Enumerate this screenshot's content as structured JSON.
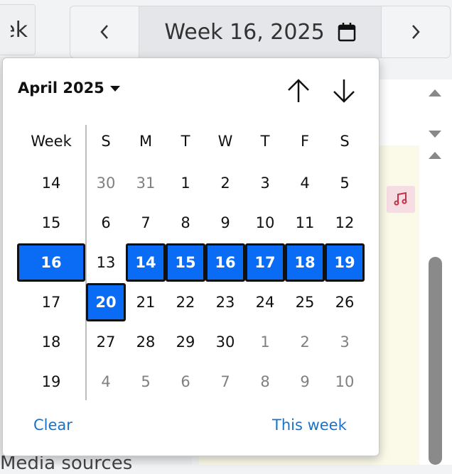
{
  "background": {
    "week_button_label": "Week",
    "week_display": "Week 16, 2025",
    "media_text": "Media sources"
  },
  "picker": {
    "month_label": "April 2025",
    "week_header": "Week",
    "day_headers": [
      "S",
      "M",
      "T",
      "W",
      "T",
      "F",
      "S"
    ],
    "weeks": [
      {
        "number": "14",
        "days": [
          "30",
          "31",
          "1",
          "2",
          "3",
          "4",
          "5"
        ]
      },
      {
        "number": "15",
        "days": [
          "6",
          "7",
          "8",
          "9",
          "10",
          "11",
          "12"
        ]
      },
      {
        "number": "16",
        "days": [
          "13",
          "14",
          "15",
          "16",
          "17",
          "18",
          "19"
        ]
      },
      {
        "number": "17",
        "days": [
          "20",
          "21",
          "22",
          "23",
          "24",
          "25",
          "26"
        ]
      },
      {
        "number": "18",
        "days": [
          "27",
          "28",
          "29",
          "30",
          "1",
          "2",
          "3"
        ]
      },
      {
        "number": "19",
        "days": [
          "4",
          "5",
          "6",
          "7",
          "8",
          "9",
          "10"
        ]
      }
    ],
    "muted": [
      [
        0,
        0
      ],
      [
        0,
        1
      ],
      [
        4,
        4
      ],
      [
        4,
        5
      ],
      [
        4,
        6
      ],
      [
        5,
        0
      ],
      [
        5,
        1
      ],
      [
        5,
        2
      ],
      [
        5,
        3
      ],
      [
        5,
        4
      ],
      [
        5,
        5
      ],
      [
        5,
        6
      ]
    ],
    "selected_cells": [
      [
        2,
        1
      ],
      [
        2,
        2
      ],
      [
        2,
        3
      ],
      [
        2,
        4
      ],
      [
        2,
        5
      ],
      [
        2,
        6
      ],
      [
        3,
        0
      ]
    ],
    "selected_week_row": 2,
    "clear_label": "Clear",
    "this_week_label": "This week"
  },
  "colors": {
    "accent": "#0a6cf5",
    "link": "#1a73c8",
    "muted_text": "#808080"
  }
}
